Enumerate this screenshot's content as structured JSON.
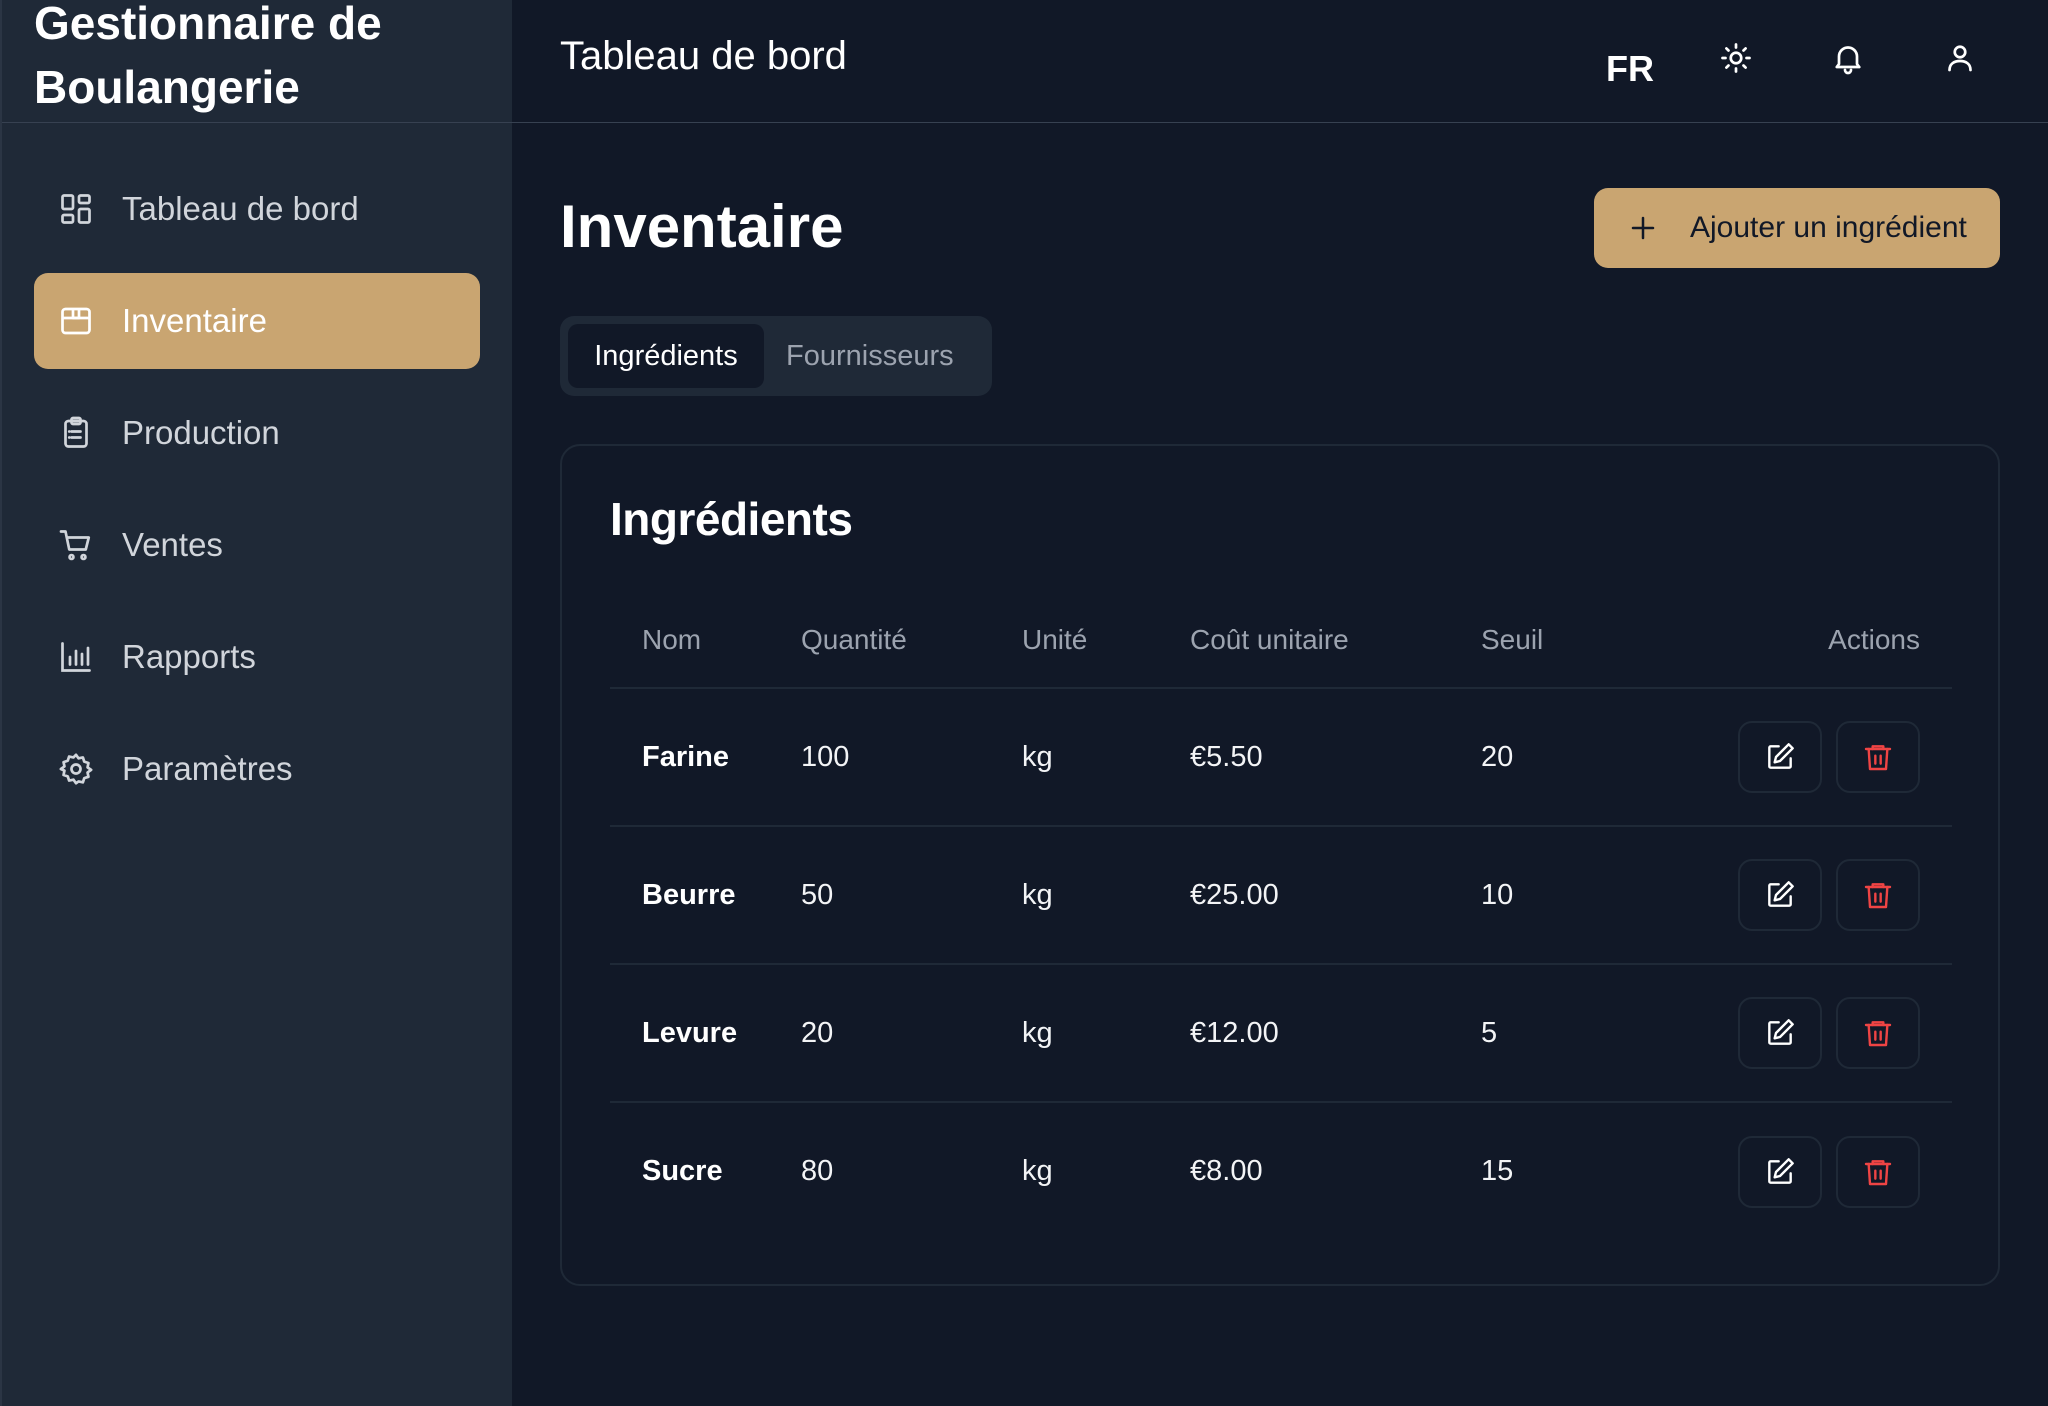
{
  "app": {
    "brand": "Gestionnaire de Boulangerie"
  },
  "topbar": {
    "title": "Tableau de bord",
    "language": "FR",
    "icons": [
      "sun-icon",
      "bell-icon",
      "user-icon"
    ]
  },
  "sidebar": {
    "items": [
      {
        "label": "Tableau de bord",
        "icon": "dashboard-grid-icon",
        "active": false
      },
      {
        "label": "Inventaire",
        "icon": "package-icon",
        "active": true
      },
      {
        "label": "Production",
        "icon": "clipboard-list-icon",
        "active": false
      },
      {
        "label": "Ventes",
        "icon": "shopping-cart-icon",
        "active": false
      },
      {
        "label": "Rapports",
        "icon": "bar-chart-icon",
        "active": false
      },
      {
        "label": "Paramètres",
        "icon": "gear-icon",
        "active": false
      }
    ]
  },
  "main": {
    "page_title": "Inventaire",
    "add_button_label": "Ajouter un ingrédient",
    "tabs": [
      {
        "label": "Ingrédients",
        "active": true
      },
      {
        "label": "Fournisseurs",
        "active": false
      }
    ],
    "card_title": "Ingrédients",
    "table": {
      "headers": [
        "Nom",
        "Quantité",
        "Unité",
        "Coût unitaire",
        "Seuil",
        "Actions"
      ],
      "rows": [
        {
          "nom": "Farine",
          "quantite": "100",
          "unite": "kg",
          "cout": "€5.50",
          "seuil": "20"
        },
        {
          "nom": "Beurre",
          "quantite": "50",
          "unite": "kg",
          "cout": "€25.00",
          "seuil": "10"
        },
        {
          "nom": "Levure",
          "quantite": "20",
          "unite": "kg",
          "cout": "€12.00",
          "seuil": "5"
        },
        {
          "nom": "Sucre",
          "quantite": "80",
          "unite": "kg",
          "cout": "€8.00",
          "seuil": "15"
        }
      ]
    }
  },
  "colors": {
    "accent": "#c9a571",
    "background": "#111827",
    "sidebar": "#1f2937",
    "delete": "#ef4444"
  }
}
